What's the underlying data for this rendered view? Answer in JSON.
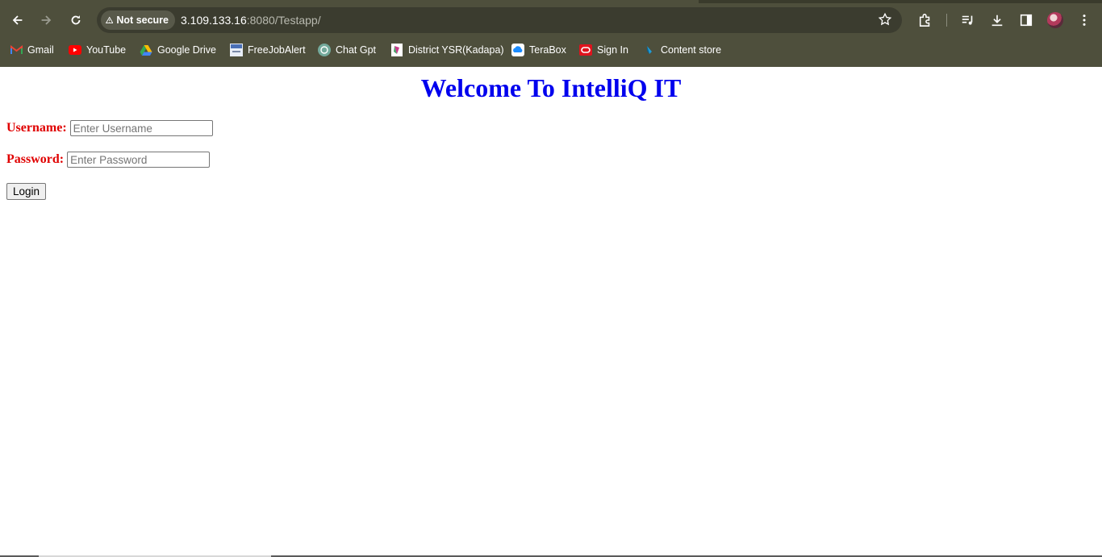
{
  "browser": {
    "security_label": "Not secure",
    "url_host": "3.109.133.16",
    "url_rest": ":8080/Testapp/"
  },
  "bookmarks": [
    {
      "label": "Gmail",
      "icon": "gmail-icon"
    },
    {
      "label": "YouTube",
      "icon": "youtube-icon"
    },
    {
      "label": "Google Drive",
      "icon": "google-drive-icon"
    },
    {
      "label": "FreeJobAlert",
      "icon": "freejobalert-icon"
    },
    {
      "label": "Chat Gpt",
      "icon": "chatgpt-icon"
    },
    {
      "label": "District YSR(Kadapa)",
      "icon": "district-icon"
    },
    {
      "label": "TeraBox",
      "icon": "terabox-icon"
    },
    {
      "label": "Sign In",
      "icon": "oracle-icon"
    },
    {
      "label": "Content store",
      "icon": "content-store-icon"
    }
  ],
  "page": {
    "title": "Welcome To IntelliQ IT",
    "username_label": "Username:",
    "username_placeholder": "Enter Username",
    "password_label": "Password:",
    "password_placeholder": "Enter Password",
    "login_label": "Login"
  },
  "colors": {
    "title": "#0000ee",
    "labels": "#e00000",
    "chrome": "#4e4f3c"
  }
}
